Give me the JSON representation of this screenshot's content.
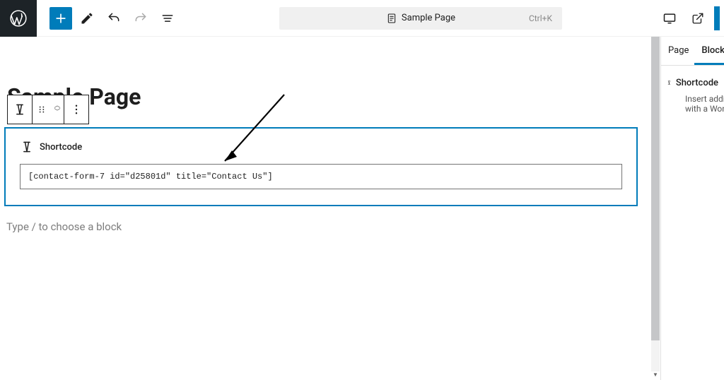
{
  "toolbar": {
    "doc_title": "Sample Page",
    "shortcut": "Ctrl+K"
  },
  "page": {
    "title": "Sample Page"
  },
  "block": {
    "label": "Shortcode",
    "value": "[contact-form-7 id=\"d25801d\" title=\"Contact Us\"]"
  },
  "paragraph_placeholder": "Type / to choose a block",
  "sidebar": {
    "tabs": {
      "page": "Page",
      "block": "Block"
    },
    "panel": {
      "title": "Shortcode",
      "desc_line1": "Insert addi",
      "desc_line2": "with a Wor"
    }
  }
}
